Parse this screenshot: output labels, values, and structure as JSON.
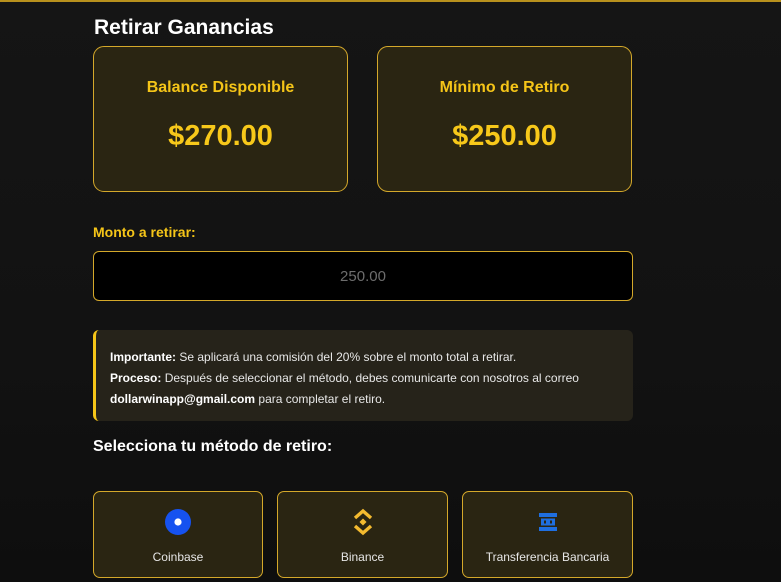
{
  "page": {
    "title": "Retirar Ganancias"
  },
  "stats": [
    {
      "label": "Balance Disponible",
      "value": "$270.00"
    },
    {
      "label": "Mínimo de Retiro",
      "value": "$250.00"
    }
  ],
  "amount": {
    "label": "Monto a retirar:",
    "placeholder": "250.00",
    "value": ""
  },
  "notice": {
    "important_label": "Importante:",
    "important_text": " Se aplicará una comisión del 20% sobre el monto total a retirar.",
    "process_label": "Proceso:",
    "process_text": " Después de seleccionar el método, debes comunicarte con nosotros al correo ",
    "email": "dollarwinapp@gmail.com",
    "process_tail": " para completar el retiro."
  },
  "methods": {
    "heading": "Selecciona tu método de retiro:",
    "items": [
      {
        "label": "Coinbase",
        "icon": "coinbase-icon",
        "color": "#1652f0"
      },
      {
        "label": "Binance",
        "icon": "binance-icon",
        "color": "#f3ba2f"
      },
      {
        "label": "Transferencia Bancaria",
        "icon": "bank-icon",
        "color": "#1f6fe0"
      }
    ]
  },
  "colors": {
    "accent": "#f5c518",
    "border": "#d4a82a",
    "card_bg": "#2a2512"
  }
}
